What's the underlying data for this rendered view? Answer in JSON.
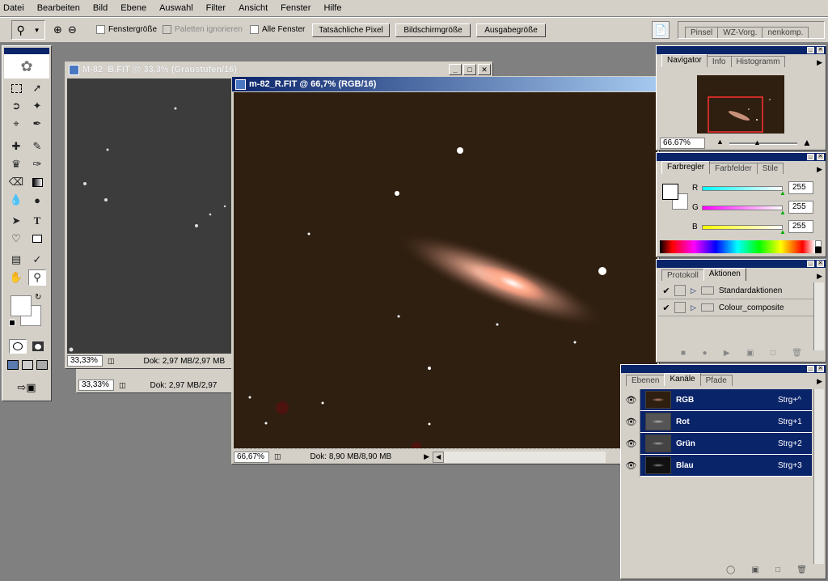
{
  "menu": [
    "Datei",
    "Bearbeiten",
    "Bild",
    "Ebene",
    "Auswahl",
    "Filter",
    "Ansicht",
    "Fenster",
    "Hilfe"
  ],
  "options_bar": {
    "checkbox_fenstergroesse": "Fenstergröße",
    "checkbox_paletten": "Paletten ignorieren",
    "checkbox_alle_fenster": "Alle Fenster",
    "btn_tatsaechliche": "Tatsächliche Pixel",
    "btn_bildschirm": "Bildschirmgröße",
    "btn_ausgabe": "Ausgabegröße",
    "palette_well_tabs": [
      "Pinsel",
      "WZ-Vorg.",
      "nenkomp."
    ]
  },
  "doc_b": {
    "title": "M-82_B.FIT @ 33,3% (Graustufen/16)",
    "zoom": "33,33%",
    "doc_info": "Dok: 2,97 MB/2,97 MB"
  },
  "doc_b_behind": {
    "zoom": "33,33%",
    "doc_info": "Dok: 2,97 MB/2,97"
  },
  "doc_r": {
    "title": "m-82_R.FIT @ 66,7% (RGB/16)",
    "zoom": "66,67%",
    "doc_info": "Dok: 8,90 MB/8,90 MB"
  },
  "navigator": {
    "tabs": [
      "Navigator",
      "Info",
      "Histogramm"
    ],
    "zoom": "66.67%"
  },
  "farbregler": {
    "tabs": [
      "Farbregler",
      "Farbfelder",
      "Stile"
    ],
    "channels": [
      {
        "label": "R",
        "value": "255",
        "gradient": "linear-gradient(90deg,#00ffff,#ffffff)"
      },
      {
        "label": "G",
        "value": "255",
        "gradient": "linear-gradient(90deg,#ff00ff,#ffffff)"
      },
      {
        "label": "B",
        "value": "255",
        "gradient": "linear-gradient(90deg,#ffff00,#ffffff)"
      }
    ]
  },
  "protokoll": {
    "tabs": [
      "Protokoll",
      "Aktionen"
    ],
    "items": [
      "Standardaktionen",
      "Colour_composite"
    ]
  },
  "ebenen": {
    "tabs": [
      "Ebenen",
      "Kanäle",
      "Pfade"
    ],
    "channels": [
      {
        "name": "RGB",
        "shortcut": "Strg+^"
      },
      {
        "name": "Rot",
        "shortcut": "Strg+1"
      },
      {
        "name": "Grün",
        "shortcut": "Strg+2"
      },
      {
        "name": "Blau",
        "shortcut": "Strg+3"
      }
    ]
  },
  "colors": {
    "accent": "#0a246a",
    "chrome": "#d4d0c8",
    "workspace": "#808080",
    "image_bg": "#2f1f10"
  }
}
